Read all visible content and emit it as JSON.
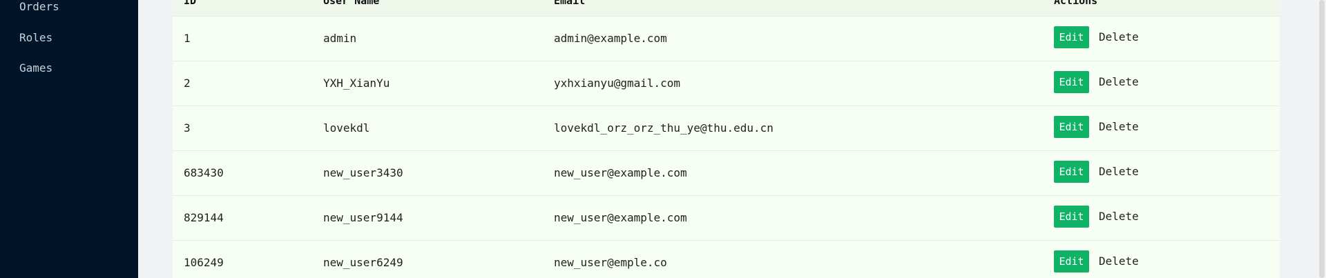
{
  "sidebar": {
    "items": [
      {
        "label": "Orders"
      },
      {
        "label": "Roles"
      },
      {
        "label": "Games"
      }
    ]
  },
  "table": {
    "headers": {
      "id": "ID",
      "username": "User Name",
      "email": "Email",
      "actions": "Actions"
    },
    "rows": [
      {
        "id": "1",
        "username": "admin",
        "email": "admin@example.com",
        "edit": "Edit",
        "delete": "Delete"
      },
      {
        "id": "2",
        "username": "YXH_XianYu",
        "email": "yxhxianyu@gmail.com",
        "edit": "Edit",
        "delete": "Delete"
      },
      {
        "id": "3",
        "username": "lovekdl",
        "email": "lovekdl_orz_orz_thu_ye@thu.edu.cn",
        "edit": "Edit",
        "delete": "Delete"
      },
      {
        "id": "683430",
        "username": "new_user3430",
        "email": "new_user@example.com",
        "edit": "Edit",
        "delete": "Delete"
      },
      {
        "id": "829144",
        "username": "new_user9144",
        "email": "new_user@example.com",
        "edit": "Edit",
        "delete": "Delete"
      },
      {
        "id": "106249",
        "username": "new_user6249",
        "email": "new_user@emple.co",
        "edit": "Edit",
        "delete": "Delete"
      }
    ]
  },
  "colors": {
    "sidebar_bg": "#001529",
    "edit_button": "#10b266",
    "row_bg": "#f7fff4"
  }
}
